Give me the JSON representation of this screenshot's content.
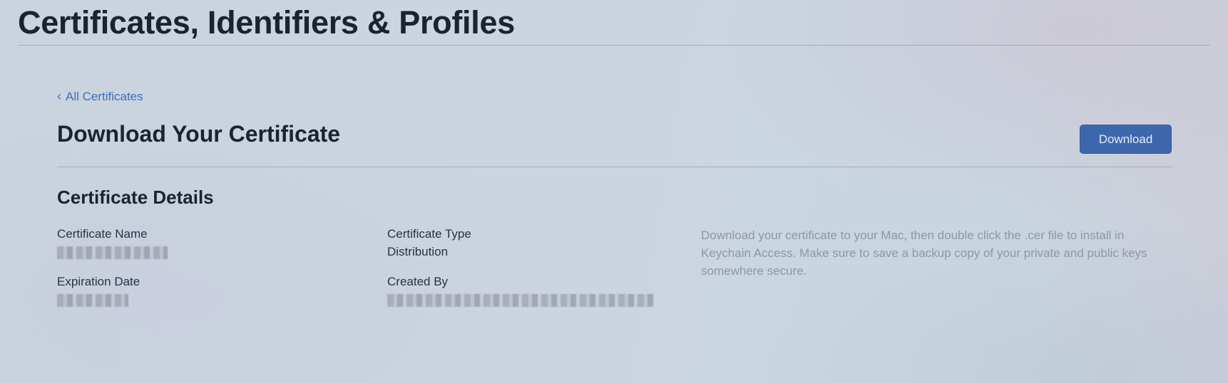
{
  "header": {
    "title": "Certificates, Identifiers & Profiles"
  },
  "nav": {
    "back_chevron": "‹",
    "back_label": "All Certificates"
  },
  "main": {
    "title": "Download Your Certificate",
    "download_label": "Download",
    "details_title": "Certificate Details",
    "fields": {
      "certificate_name_label": "Certificate Name",
      "certificate_type_label": "Certificate Type",
      "certificate_type_value": "Distribution",
      "expiration_date_label": "Expiration Date",
      "created_by_label": "Created By"
    },
    "help_text": "Download your certificate to your Mac, then double click the .cer file to install in Keychain Access. Make sure to save a backup copy of your private and public keys somewhere secure."
  },
  "colors": {
    "accent": "#3d67ad",
    "link": "#3c6fb8",
    "heading": "#1b2230",
    "muted_text": "#8e97a6"
  }
}
